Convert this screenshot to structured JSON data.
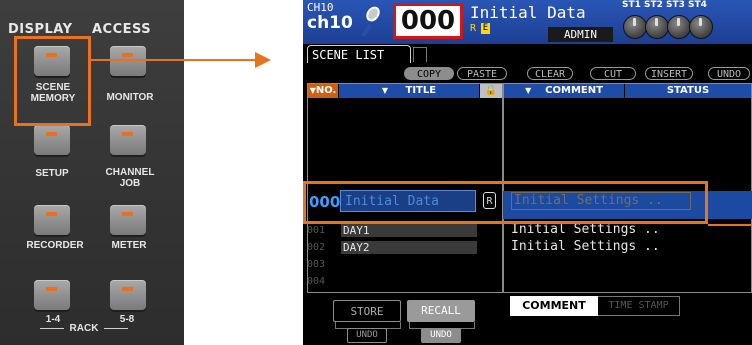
{
  "console": {
    "title_left": "DISPLAY",
    "title_right": "ACCESS",
    "buttons": [
      {
        "label": "SCENE\nMEMORY"
      },
      {
        "label": "MONITOR"
      },
      {
        "label": "SETUP"
      },
      {
        "label": "CHANNEL\nJOB"
      },
      {
        "label": "RECORDER"
      },
      {
        "label": "METER"
      },
      {
        "label": "1-4"
      },
      {
        "label": "5-8"
      }
    ],
    "rack_label": "RACK",
    "led_color": "#e8701e",
    "highlight_color": "#e8731e"
  },
  "lcd": {
    "channel_number": "CH10",
    "channel_name": "ch10",
    "mic_icon": "microphone-icon",
    "scene_number": "000",
    "scene_title": "Initial Data",
    "flag_r": "R",
    "flag_e": "E",
    "user": "ADMIN",
    "stereo_labels": [
      "ST1",
      "ST2",
      "ST3",
      "ST4"
    ],
    "tab_label": "SCENE LIST",
    "toolbar": {
      "copy": "COPY",
      "paste": "PASTE",
      "clear": "CLEAR",
      "cut": "CUT",
      "insert": "INSERT",
      "undo": "UNDO"
    },
    "columns": {
      "no": "NO.",
      "title": "TITLE",
      "lock": "lock-icon",
      "comment": "COMMENT",
      "status": "STATUS"
    },
    "selected": {
      "number": "000",
      "title": "Initial Data",
      "lock": "R",
      "comment": "Initial Settings .."
    },
    "rows": [
      {
        "number": "001",
        "title": "DAY1",
        "comment": "Initial Settings .."
      },
      {
        "number": "002",
        "title": "DAY2",
        "comment": "Initial Settings .."
      },
      {
        "number": "003",
        "title": "",
        "comment": ""
      },
      {
        "number": "004",
        "title": "",
        "comment": ""
      }
    ],
    "store_label": "STORE",
    "recall_label": "RECALL",
    "undo_label": "UNDO",
    "bottom_tabs": {
      "comment": "COMMENT",
      "time_stamp": "TIME STAMP"
    },
    "accent_blue": "#1e4ca6",
    "accent_orange": "#d06010",
    "scene_box_border": "#d01818"
  }
}
